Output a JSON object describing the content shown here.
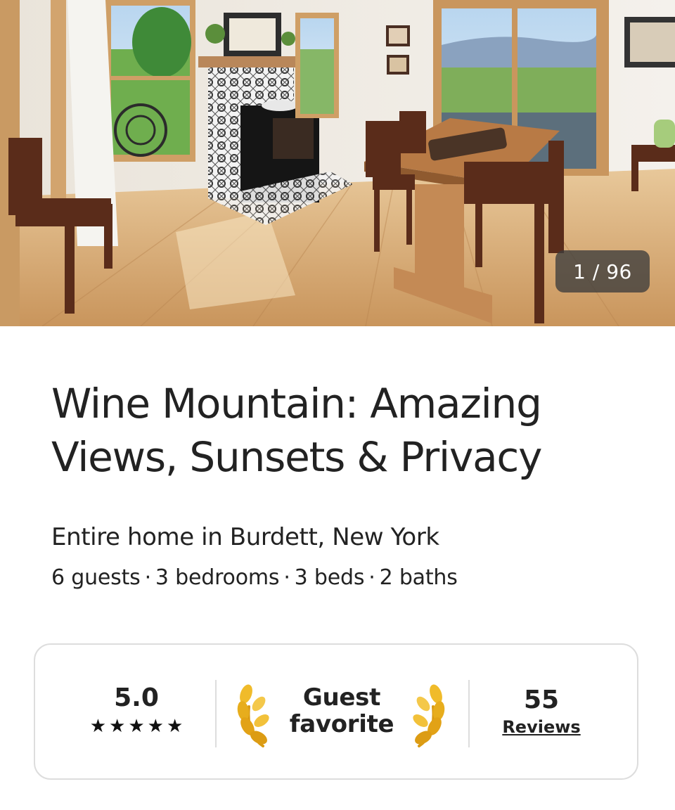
{
  "photo": {
    "counter": "1 / 96"
  },
  "listing": {
    "title": "Wine Mountain: Amazing Views, Sunsets & Privacy",
    "subtitle": "Entire home in Burdett, New York",
    "details": [
      "6 guests",
      "3 bedrooms",
      "3 beds",
      "2 baths"
    ],
    "separator": "·"
  },
  "highlights": {
    "rating": "5.0",
    "stars": 5,
    "star_glyph": "★",
    "badge_line1": "Guest",
    "badge_line2": "favorite",
    "reviews_count": "55",
    "reviews_label": "Reviews",
    "laurel_icon": "laurel-icon"
  },
  "colors": {
    "text": "#222222",
    "border": "#dddddd",
    "laurel_gold": "#e0a81e"
  }
}
